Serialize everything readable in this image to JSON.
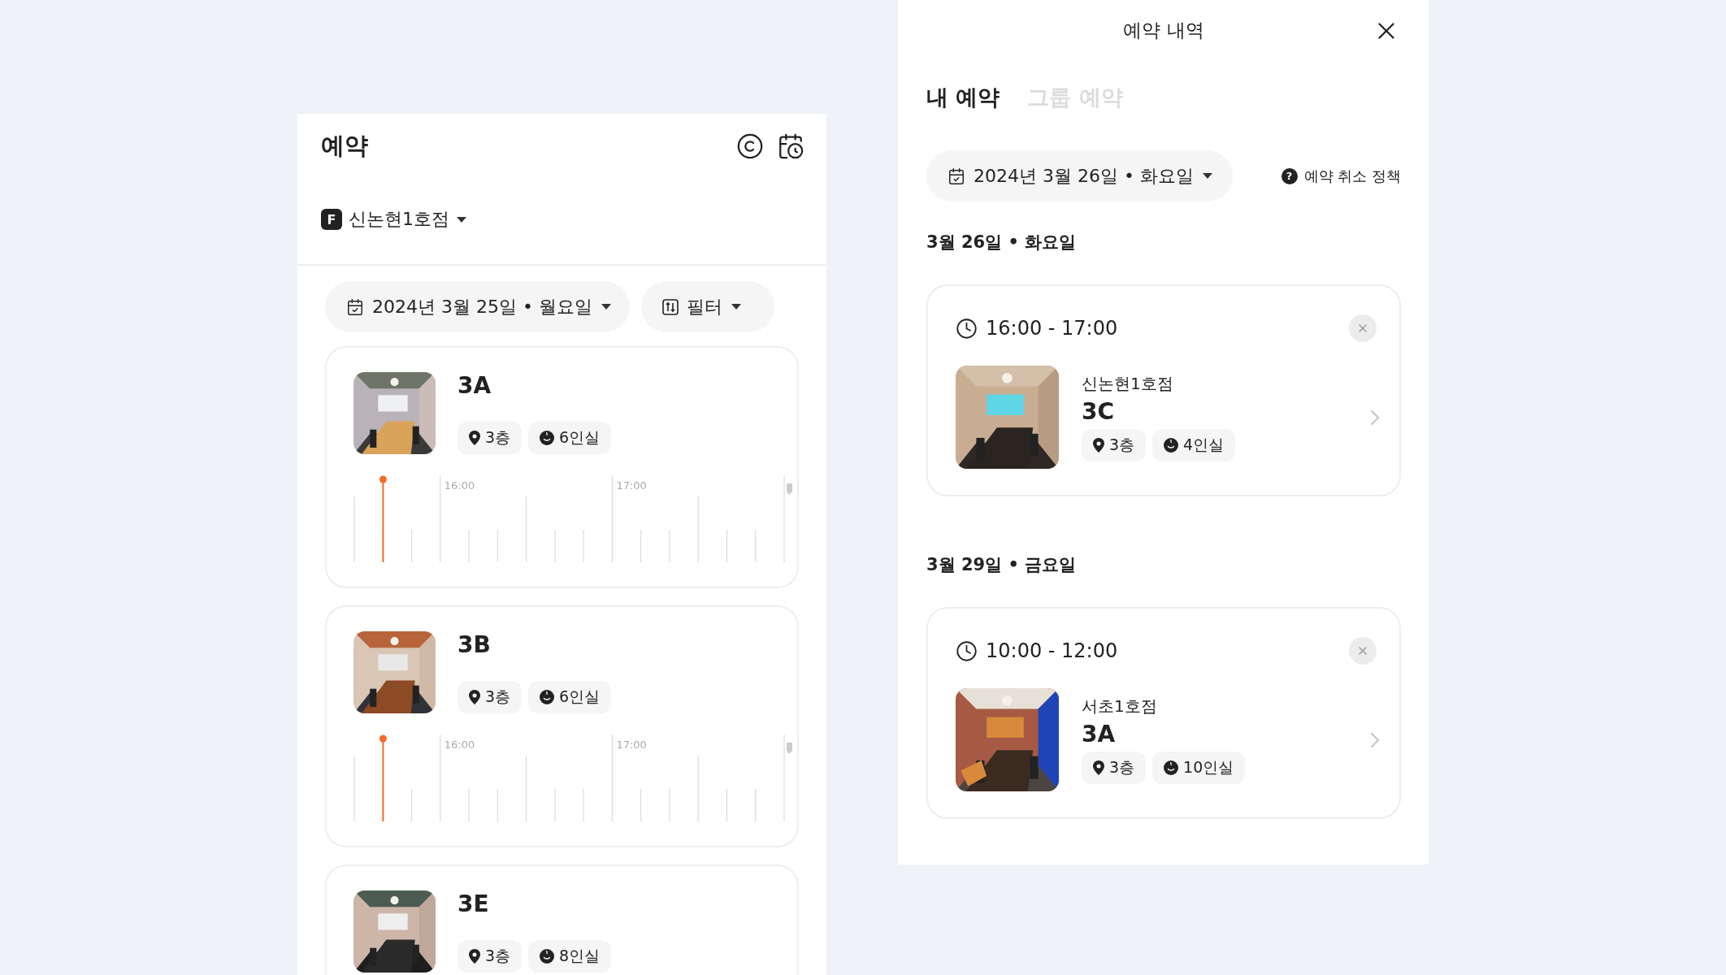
{
  "reservation": {
    "title": "예약",
    "branch": {
      "badge": "F",
      "name": "신논현1호점"
    },
    "date": "2024년 3월 25일 • 월요일",
    "filter": "필터",
    "rooms": [
      {
        "name": "3A",
        "tags": [
          {
            "kind": "floor",
            "label": "3층"
          },
          {
            "kind": "capacity",
            "label": "6인실"
          }
        ],
        "timeline": {
          "labels": [
            "16:00",
            "17:00"
          ],
          "level": 0.067
        }
      },
      {
        "name": "3B",
        "tags": [
          {
            "kind": "floor",
            "label": "3층"
          },
          {
            "kind": "capacity",
            "label": "6인실"
          }
        ],
        "timeline": {
          "labels": [
            "16:00",
            "17:00"
          ],
          "level": 0.067
        }
      },
      {
        "name": "3E",
        "tags": [
          {
            "kind": "floor",
            "label": "3층"
          },
          {
            "kind": "capacity",
            "label": "8인실"
          }
        ]
      }
    ]
  },
  "history": {
    "title": "예약 내역",
    "tabs": [
      {
        "label": "내 예약",
        "selected": true
      },
      {
        "label": "그룹 예약",
        "selected": false
      }
    ],
    "date": "2024년 3월 26일 • 화요일",
    "policy": {
      "icon": "?",
      "label": "예약 취소 정책"
    },
    "days": [
      {
        "heading": "3월 26일 • 화요일",
        "bookings": [
          {
            "time": "16:00 - 17:00",
            "branch": "신논현1호점",
            "room": "3C",
            "tags": [
              {
                "kind": "floor",
                "label": "3층"
              },
              {
                "kind": "capacity",
                "label": "4인실"
              }
            ]
          }
        ]
      },
      {
        "heading": "3월 29일 • 금요일",
        "bookings": [
          {
            "time": "10:00 - 12:00",
            "branch": "서초1호점",
            "room": "3A",
            "tags": [
              {
                "kind": "floor",
                "label": "3층"
              },
              {
                "kind": "capacity",
                "label": "10인실"
              }
            ]
          }
        ]
      }
    ]
  }
}
